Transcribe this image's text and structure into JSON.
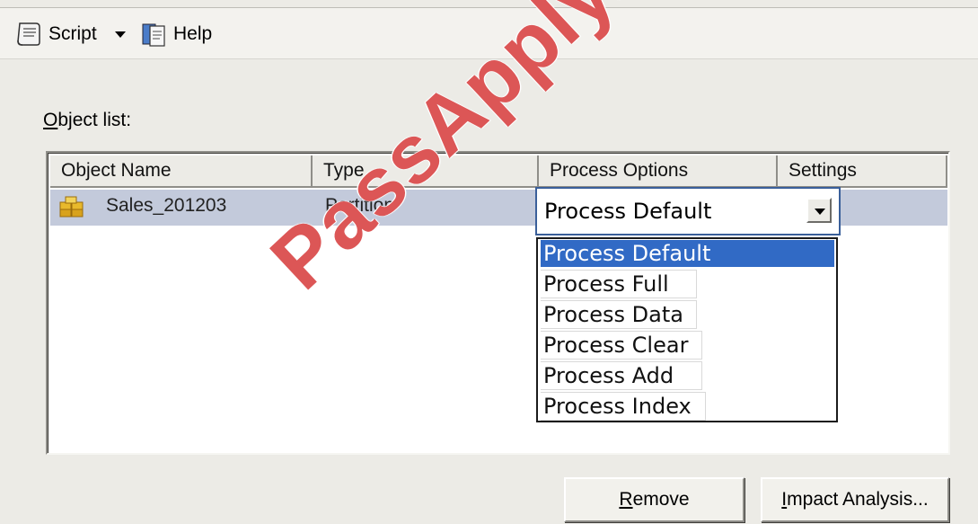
{
  "toolbar": {
    "script_label": "Script",
    "help_label": "Help"
  },
  "object_list": {
    "label_first_letter": "O",
    "label_rest": "bject list:",
    "columns": [
      "Object Name",
      "Type",
      "Process Options",
      "Settings"
    ],
    "rows": [
      {
        "name": "Sales_201203",
        "type": "Partition",
        "process_option": "Process Default",
        "settings": ""
      }
    ]
  },
  "dropdown": {
    "selected": "Process Default",
    "options": [
      "Process Default",
      "Process Full",
      "Process Data",
      "Process Clear",
      "Process Add",
      "Process Index"
    ],
    "highlighted_index": 0
  },
  "buttons": {
    "remove_first_letter": "R",
    "remove_rest": "emove",
    "impact_first_letter": "I",
    "impact_rest": "mpact Analysis..."
  },
  "watermark": {
    "text": "PassApply.com"
  },
  "colors": {
    "selection_row": "#c3cadb",
    "list_highlight": "#316ac5",
    "watermark": "#d63838"
  }
}
